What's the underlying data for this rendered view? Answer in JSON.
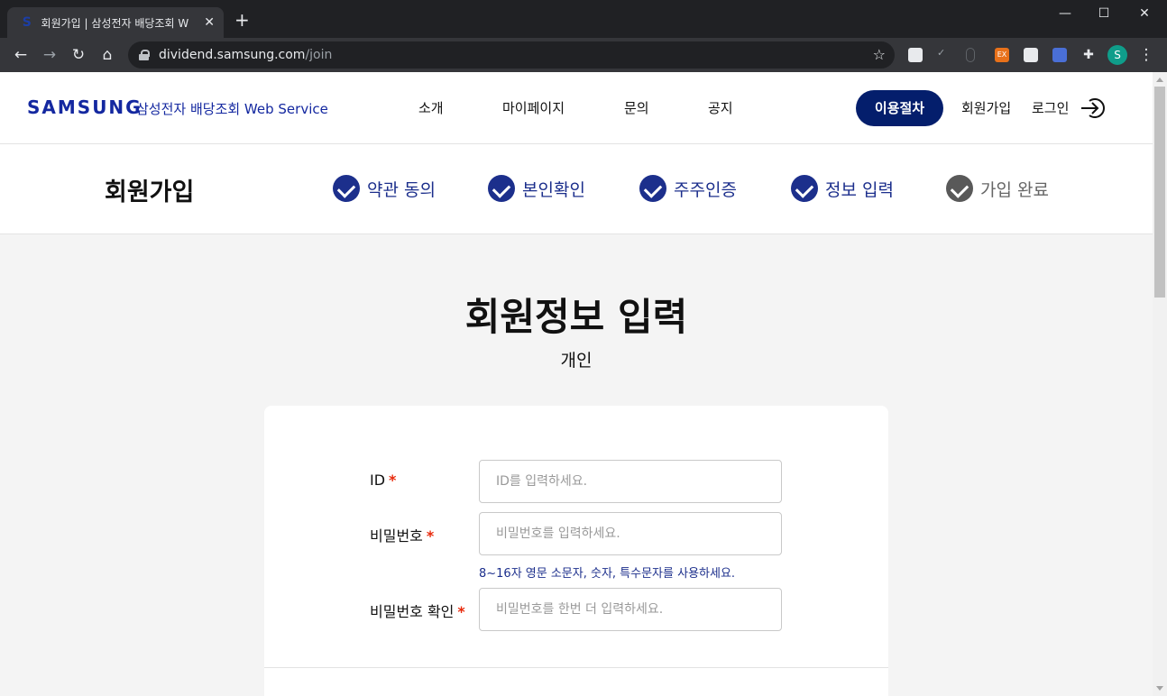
{
  "browser": {
    "tab_title": "회원가입 | 삼성전자 배당조회 W",
    "favicon": "S",
    "url_host": "dividend.samsung.com",
    "url_path": "/join",
    "profile_initial": "S",
    "ext_badge": "EX"
  },
  "header": {
    "logo": "SAMSUNG",
    "service_name": "삼성전자 배당조회 Web Service",
    "nav": [
      "소개",
      "마이페이지",
      "문의",
      "공지"
    ],
    "process_button": "이용절차",
    "join_link": "회원가입",
    "login_link": "로그인"
  },
  "steps": {
    "title": "회원가입",
    "items": [
      {
        "label": "약관 동의",
        "status": "done"
      },
      {
        "label": "본인확인",
        "status": "done"
      },
      {
        "label": "주주인증",
        "status": "done"
      },
      {
        "label": "정보 입력",
        "status": "done"
      },
      {
        "label": "가입 완료",
        "status": "todo"
      }
    ]
  },
  "form": {
    "title": "회원정보 입력",
    "subtitle": "개인",
    "fields": {
      "id": {
        "label": "ID",
        "placeholder": "ID를 입력하세요."
      },
      "password": {
        "label": "비밀번호",
        "placeholder": "비밀번호를 입력하세요.",
        "hint": "8~16자 영문 소문자, 숫자, 특수문자를 사용하세요."
      },
      "password_confirm": {
        "label": "비밀번호 확인",
        "placeholder": "비밀번호를 한번 더 입력하세요."
      }
    },
    "required_mark": "*"
  },
  "colors": {
    "brand": "#1428a0",
    "primary_button": "#041e6c",
    "step_done": "#1c2f8c",
    "step_todo": "#595959",
    "required": "#e8290b"
  }
}
